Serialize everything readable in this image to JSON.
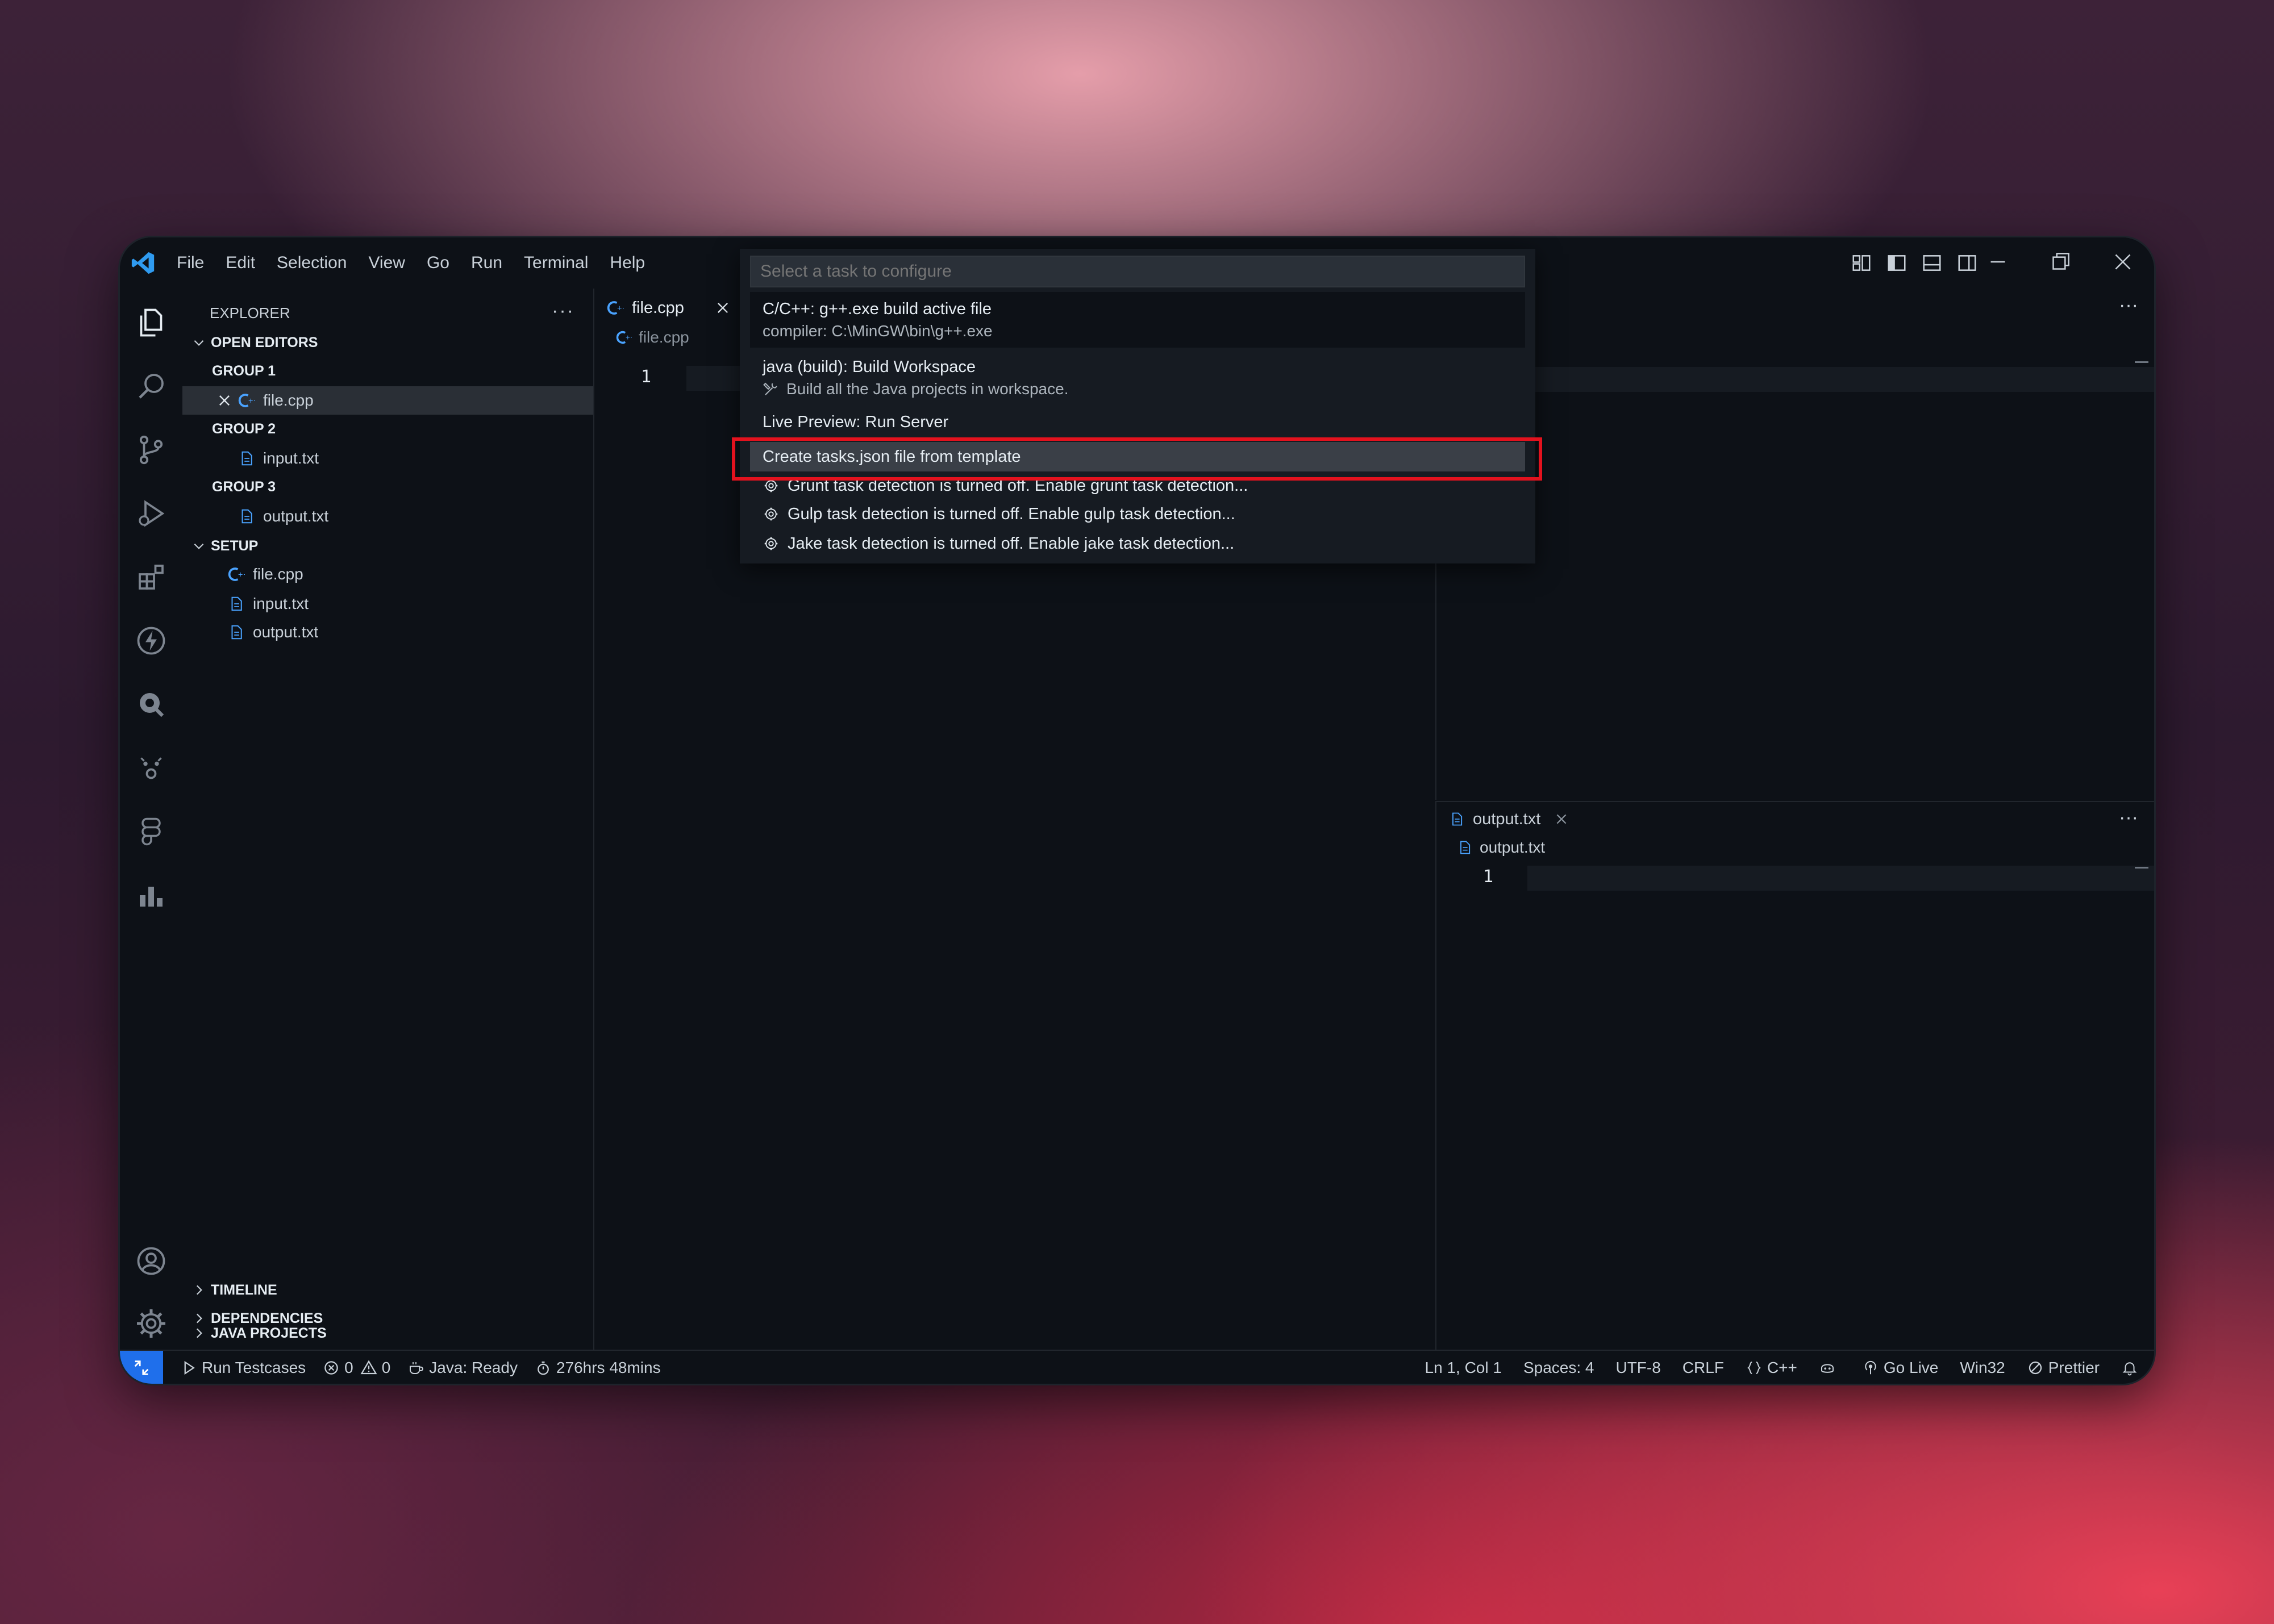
{
  "menu": [
    "File",
    "Edit",
    "Selection",
    "View",
    "Go",
    "Run",
    "Terminal",
    "Help"
  ],
  "sidebar": {
    "title": "EXPLORER",
    "more": "···",
    "open_editors": "OPEN EDITORS",
    "group1": "GROUP 1",
    "group1_file": "file.cpp",
    "group2": "GROUP 2",
    "group2_file": "input.txt",
    "group3": "GROUP 3",
    "group3_file": "output.txt",
    "setup": "SETUP",
    "setup_files": [
      "file.cpp",
      "input.txt",
      "output.txt"
    ],
    "timeline": "TIMELINE",
    "dependencies": "DEPENDENCIES",
    "java_projects": "JAVA PROJECTS"
  },
  "editor_left": {
    "tab": "file.cpp",
    "breadcrumb": "file.cpp",
    "line": "1"
  },
  "editor_right_bottom": {
    "tab": "output.txt",
    "breadcrumb": "output.txt",
    "line": "1",
    "more": "···"
  },
  "editor_right_top": {
    "more": "···"
  },
  "palette": {
    "placeholder": "Select a task to configure",
    "items": [
      {
        "label": "C/C++: g++.exe build active file",
        "desc": "compiler: C:\\MinGW\\bin\\g++.exe"
      },
      {
        "label": "java (build): Build Workspace",
        "desc": "Build all the Java projects in workspace."
      },
      {
        "label": "Live Preview: Run Server"
      },
      {
        "label": "Create tasks.json file from template"
      },
      {
        "label": "Grunt task detection is turned off. Enable grunt task detection..."
      },
      {
        "label": "Gulp task detection is turned off. Enable gulp task detection..."
      },
      {
        "label": "Jake task detection is turned off. Enable jake task detection..."
      }
    ]
  },
  "status": {
    "run_testcases": "Run Testcases",
    "errors": "0",
    "warnings": "0",
    "java": "Java: Ready",
    "time": "276hrs 48mins",
    "position": "Ln 1, Col 1",
    "spaces": "Spaces: 4",
    "encoding": "UTF-8",
    "eol": "CRLF",
    "language": "C++",
    "golive": "Go Live",
    "platform": "Win32",
    "prettier": "Prettier"
  },
  "colors": {
    "accent": "#1f6feb",
    "highlight_box": "#e3121e",
    "cpp_icon": "#4aa3ff",
    "txt_icon": "#4aa3ff"
  }
}
